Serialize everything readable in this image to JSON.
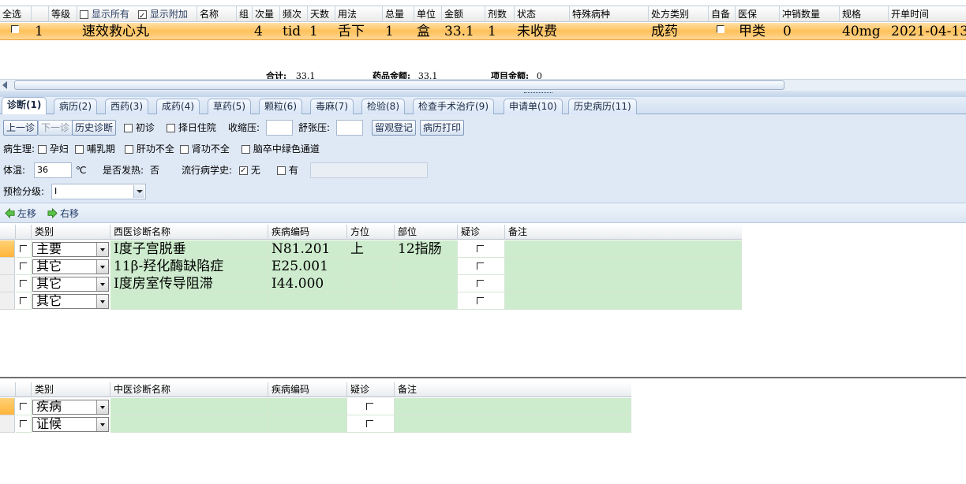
{
  "top_grid": {
    "headers": [
      "全选",
      "等级",
      "显示所有",
      "显示附加",
      "名称",
      "组",
      "次量",
      "频次",
      "天数",
      "用法",
      "总量",
      "单位",
      "金额",
      "剂数",
      "状态",
      "特殊病种",
      "处方类别",
      "自备",
      "医保",
      "冲销数量",
      "规格",
      "开单时间"
    ],
    "show_all_checked": false,
    "show_extra_checked": true,
    "row": {
      "index": "1",
      "name": "速效救心丸",
      "dose": "4",
      "freq": "tid",
      "days": "1",
      "usage": "舌下",
      "total": "1",
      "unit": "盒",
      "amount": "33.1",
      "doses": "1",
      "status": "未收费",
      "category": "成药",
      "insurance": "甲类",
      "offset": "0",
      "spec": "40mg",
      "time": "2021-04-13"
    },
    "summary": {
      "total_label": "合计:",
      "total_value": "33.1",
      "drug_label": "药品金额:",
      "drug_value": "33.1",
      "item_label": "项目金额:",
      "item_value": "0"
    }
  },
  "tabs": [
    {
      "label": "诊断(1)"
    },
    {
      "label": "病历(2)"
    },
    {
      "label": "西药(3)"
    },
    {
      "label": "成药(4)"
    },
    {
      "label": "草药(5)"
    },
    {
      "label": "颗粒(6)"
    },
    {
      "label": "毒麻(7)"
    },
    {
      "label": "检验(8)"
    },
    {
      "label": "检查手术治疗(9)"
    },
    {
      "label": "申请单(10)"
    },
    {
      "label": "历史病历(11)"
    }
  ],
  "form": {
    "prev_btn": "上一诊",
    "next_btn": "下一诊",
    "history_btn": "历史诊断",
    "first_visit": "初诊",
    "hospital": "择日住院",
    "systolic_label": "收缩压:",
    "diastolic_label": "舒张压:",
    "observe_btn": "留观登记",
    "print_btn": "病历打印",
    "physiology_label": "病生理:",
    "pregnant": "孕妇",
    "lactation": "哺乳期",
    "liver": "肝功不全",
    "kidney": "肾功不全",
    "stroke": "脑卒中绿色通道",
    "temp_label": "体温:",
    "temp_value": "36",
    "temp_unit": "℃",
    "fever_label": "是否发热:",
    "fever_value": "否",
    "epi_label": "流行病学史:",
    "epi_none": "无",
    "epi_has": "有",
    "triage_label": "预检分级:",
    "triage_value": "I"
  },
  "move": {
    "left": "左移",
    "right": "右移"
  },
  "western_grid": {
    "headers": [
      "类别",
      "西医诊断名称",
      "疾病编码",
      "方位",
      "部位",
      "疑诊",
      "备注"
    ],
    "rows": [
      {
        "type": "主要",
        "name": "Ⅰ度子宫脱垂",
        "code": "N81.201",
        "direction": "上",
        "site": "12指肠"
      },
      {
        "type": "其它",
        "name": "11β-羟化酶缺陷症",
        "code": "E25.001",
        "direction": "",
        "site": ""
      },
      {
        "type": "其它",
        "name": "Ⅰ度房室传导阻滞",
        "code": "I44.000",
        "direction": "",
        "site": ""
      },
      {
        "type": "其它",
        "name": "",
        "code": "",
        "direction": "",
        "site": ""
      }
    ]
  },
  "chinese_grid": {
    "headers": [
      "类别",
      "中医诊断名称",
      "疾病编码",
      "疑诊",
      "备注"
    ],
    "rows": [
      {
        "type": "疾病"
      },
      {
        "type": "证候"
      }
    ]
  },
  "colors": {
    "selected_row": "#ffc15a",
    "grid_cell": "#cdeccd",
    "panel": "#dfe9f6"
  }
}
